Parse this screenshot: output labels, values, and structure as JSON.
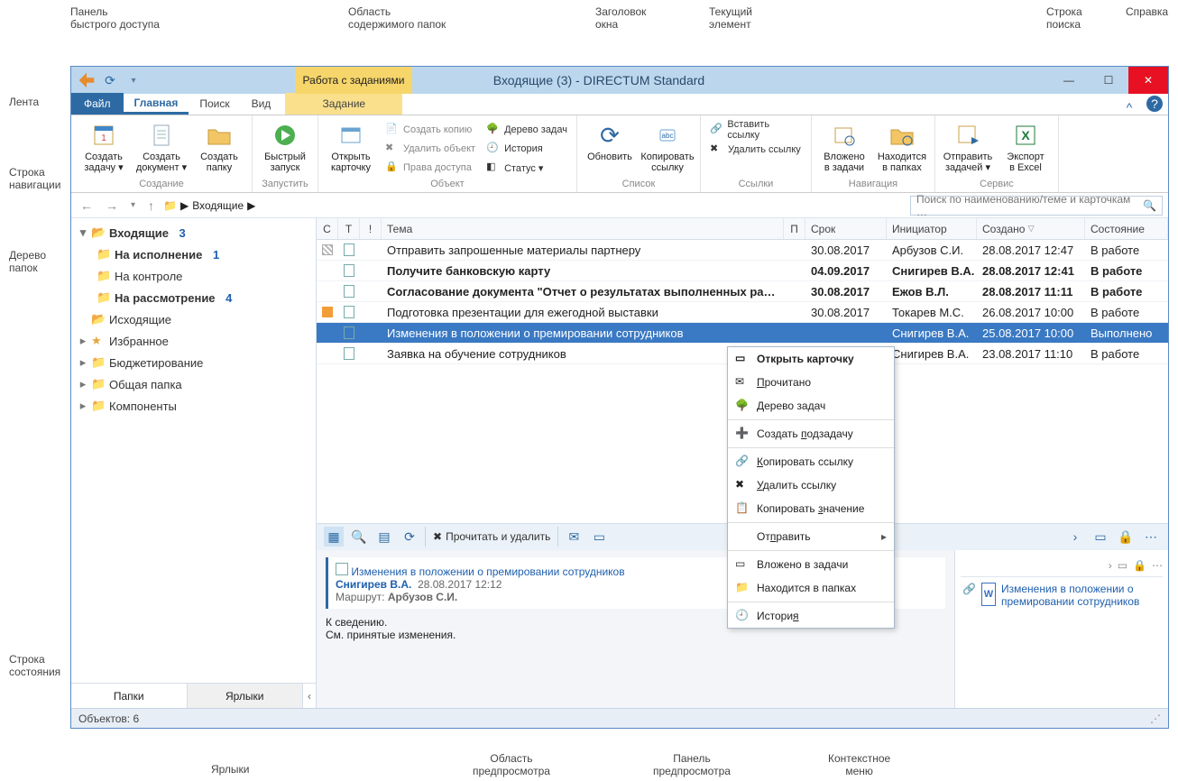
{
  "window": {
    "title": "Входящие (3) - DIRECTUM Standard"
  },
  "tabs": {
    "file": "Файл",
    "home": "Главная",
    "search": "Поиск",
    "view": "Вид",
    "context_group": "Работа с заданиями",
    "context_tab": "Задание"
  },
  "ribbon": {
    "group1": "Создание",
    "g1b1": "Создать\nзадачу ▾",
    "g1b2": "Создать\nдокумент ▾",
    "g1b3": "Создать\nпапку",
    "group2": "Запустить",
    "g2b1": "Быстрый\nзапуск",
    "group3": "Объект",
    "g3b1": "Открыть\nкарточку",
    "g3s1": "Создать копию",
    "g3s2": "Удалить объект",
    "g3s3": "Права доступа",
    "g3s4": "Дерево задач",
    "g3s5": "История",
    "g3s6": "Статус ▾",
    "group4": "Список",
    "g4b1": "Обновить",
    "g4b2": "Копировать\nссылку",
    "group5": "Ссылки",
    "g5s1": "Вставить ссылку",
    "g5s2": "Удалить ссылку",
    "group6": "Навигация",
    "g6b1": "Вложено\nв задачи",
    "g6b2": "Находится\nв папках",
    "group7": "Сервис",
    "g7b1": "Отправить\nзадачей ▾",
    "g7b2": "Экспорт\nв Excel"
  },
  "nav": {
    "folder": "Входящие",
    "sep": "▶"
  },
  "search": {
    "placeholder": "Поиск по наименованию/теме и карточкам …"
  },
  "tree": {
    "inbox": {
      "label": "Входящие",
      "count": "3"
    },
    "exec": {
      "label": "На исполнение",
      "count": "1"
    },
    "control": {
      "label": "На контроле"
    },
    "consider": {
      "label": "На рассмотрение",
      "count": "4"
    },
    "outbox": "Исходящие",
    "fav": "Избранное",
    "budget": "Бюджетирование",
    "shared": "Общая папка",
    "components": "Компоненты",
    "tab_folders": "Папки",
    "tab_short": "Ярлыки"
  },
  "grid": {
    "cols": {
      "c": "С",
      "t": "Т",
      "b": "!",
      "tema": "Тема",
      "p": "П",
      "srok": "Срок",
      "init": "Инициатор",
      "sozd": "Создано",
      "sost": "Состояние"
    },
    "rows": [
      {
        "t": "hatch",
        "tema": "Отправить запрошенные материалы партнеру",
        "srok": "30.08.2017",
        "init": "Арбузов С.И.",
        "sozd": "28.08.2017 12:47",
        "sost": "В работе",
        "bold": false,
        "c": "h"
      },
      {
        "t": "cal",
        "tema": "Получите банковскую карту",
        "srok": "04.09.2017",
        "init": "Снигирев В.А.",
        "sozd": "28.08.2017 12:41",
        "sost": "В работе",
        "bold": true
      },
      {
        "t": "cal",
        "tema": "Согласование документа \"Отчет о результатах выполненных ра…",
        "srok": "30.08.2017",
        "init": "Ежов В.Л.",
        "sozd": "28.08.2017 11:11",
        "sost": "В работе",
        "bold": true
      },
      {
        "t": "cal",
        "tema": "Подготовка презентации для ежегодной выставки",
        "srok": "30.08.2017",
        "init": "Токарев М.С.",
        "sozd": "26.08.2017 10:00",
        "sost": "В работе",
        "c": "o",
        "bold": false
      },
      {
        "t": "cal",
        "tema": "Изменения в положении о премировании сотрудников",
        "srok": "",
        "init": "Снигирев В.А.",
        "sozd": "25.08.2017 10:00",
        "sost": "Выполнено",
        "sel": true
      },
      {
        "t": "cal",
        "tema": "Заявка на обучение сотрудников",
        "srok": "",
        "init": "Снигирев В.А.",
        "sozd": "23.08.2017 11:10",
        "sost": "В работе"
      }
    ]
  },
  "preview_tb": {
    "btn_readdel": "Прочитать и удалить"
  },
  "preview": {
    "title": "Изменения в положении о премировании сотрудников",
    "from": "Снигирев В.А.",
    "date": "28.08.2017 12:12",
    "route_lbl": "Маршрут:",
    "route_val": "Арбузов С.И.",
    "body1": "К сведению.",
    "body2": "См. принятые изменения."
  },
  "right": {
    "doc": "Изменения в положении о премировании сотрудников"
  },
  "status": {
    "objects": "Объектов: 6"
  },
  "ctx": {
    "open": "Открыть карточку",
    "read": "Прочитано",
    "tree": "Дерево задач",
    "subtask": "Создать подзадачу",
    "copylnk": "Копировать ссылку",
    "dellnk": "Удалить ссылку",
    "copyval": "Копировать значение",
    "send": "Отправить",
    "intasks": "Вложено в задачи",
    "infolders": "Находится в папках",
    "history": "История"
  },
  "callouts": {
    "qat": "Панель\nбыстрого доступа",
    "ribbon": "Лента",
    "navrow": "Строка\nнавигации",
    "tree": "Дерево\nпапок",
    "status": "Строка\nсостояния",
    "short": "Ярлыки",
    "preview_area": "Область\nпредпросмотра",
    "preview_panel": "Панель\nпредпросмотра",
    "ctx": "Контекстное\nменю",
    "folder_content": "Область\nсодержимого папок",
    "title": "Заголовок\nокна",
    "current": "Текущий\nэлемент",
    "search": "Строка\nпоиска",
    "help": "Справка"
  }
}
